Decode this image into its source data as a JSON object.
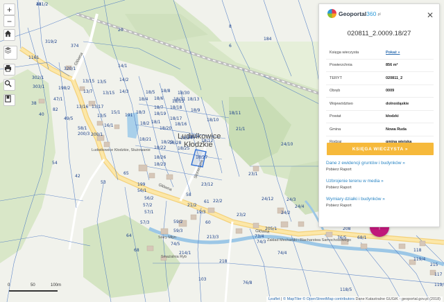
{
  "map": {
    "place_name_1": "Ludwikowice",
    "place_name_2": "Kłodzkie",
    "road_name_1": "Główna",
    "road_name_2": "Słoneczna",
    "parcel_labels": [
      "311/2",
      "20",
      "8",
      "319/2",
      "374",
      "6",
      "184",
      "1161",
      "320/1",
      "14/1",
      "14/2",
      "302/1",
      "13/15",
      "13/5",
      "13/7",
      "13/15",
      "198/2",
      "303/1",
      "47/1",
      "14/3",
      "13/16",
      "13/17",
      "13/5",
      "15/1",
      "38",
      "40",
      "49/5",
      "16/1",
      "191",
      "18/6",
      "18/7",
      "18/9",
      "18/10",
      "18/11",
      "18/19",
      "18/18",
      "18/17",
      "18/15",
      "18/13",
      "18/14",
      "18/16",
      "18/12",
      "18/21",
      "18/22",
      "18/25",
      "18/24",
      "18/26",
      "18/23",
      "18/27",
      "18/20",
      "18/28",
      "18/29",
      "18/31",
      "18/2",
      "18/3",
      "18/4",
      "18/5",
      "18/8",
      "18/30",
      "18/1",
      "21/1",
      "24/10",
      "200/1",
      "200/3",
      "58/1",
      "42",
      "54",
      "53",
      "65",
      "199",
      "56/1",
      "56/2",
      "57/2",
      "57/1",
      "57/3",
      "58",
      "19/3",
      "60",
      "59/2",
      "59/3",
      "61",
      "68",
      "64",
      "23/1",
      "23/2",
      "24/12",
      "22/2",
      "23/12",
      "21/2",
      "24/2",
      "24/4",
      "24/3",
      "205/1",
      "73/4",
      "74/3",
      "74/4",
      "74/5",
      "213/3",
      "214/1",
      "208",
      "68/1",
      "76/5",
      "76/8",
      "103",
      "218",
      "215",
      "117",
      "118",
      "119/4",
      "119/5",
      "118/5",
      "82",
      "48"
    ],
    "small_labels": [
      "Ludwikowice Kłodzkie, Służowanie",
      "Stary Młyn",
      "Smażalnia Ryb",
      "Zakład Mechaniki i Blacharstwa Samochodowego"
    ]
  },
  "controls": {
    "zoom_in": "+",
    "zoom_out": "−",
    "home_icon": "home-icon",
    "layers_icon": "layers-icon",
    "print_icon": "print-icon",
    "search_icon": "search-icon",
    "bookmark_icon": "bookmark-icon"
  },
  "scale": {
    "t0": "0",
    "t1": "50",
    "t2": "100m"
  },
  "attribution": {
    "leaflet": "Leaflet",
    "maptiler": "© MapTiler",
    "osm": "© OpenStreetMap contributors",
    "rest": "Dane Katastralne GUGiK - geoportal.gov.pl (2018)"
  },
  "panel": {
    "logo_geoportal": "Geoportal",
    "logo_360": "360",
    "logo_pl": ".pl",
    "parcel_id": "020811_2.0009.18/27",
    "attributes": [
      {
        "key": "Księga wieczysta",
        "value": "Pokaż »",
        "link": true
      },
      {
        "key": "Powierzchnia",
        "value": "856 m²",
        "link": false
      },
      {
        "key": "TERYT",
        "value": "020811_2",
        "link": false
      },
      {
        "key": "Obręb",
        "value": "0009",
        "link": false
      },
      {
        "key": "Województwo",
        "value": "dolnośląskie",
        "link": false
      },
      {
        "key": "Powiat",
        "value": "kłodzki",
        "link": false
      },
      {
        "key": "Gmina",
        "value": "Nowa Ruda",
        "link": false
      },
      {
        "key": "Rodzaj",
        "value": "gmina wiejska",
        "link": false
      }
    ],
    "kw_button": "KSIĘGA WIECZYSTA »",
    "sections": [
      {
        "title": "Dane z ewidencji gruntów i budynków »",
        "sub": "Pobierz Raport"
      },
      {
        "title": "Uzbrojenie terenu w media »",
        "sub": "Pobierz Raport"
      },
      {
        "title": "Wymiary działki i budynków »",
        "sub": "Pobierz Raport"
      }
    ]
  },
  "fab_icon": "arrow-up-icon",
  "colors": {
    "accent_orange": "#f6b93b",
    "link_blue": "#2b86c5",
    "fab_magenta": "#c0187a",
    "parcel_line": "#2e6fd6"
  }
}
